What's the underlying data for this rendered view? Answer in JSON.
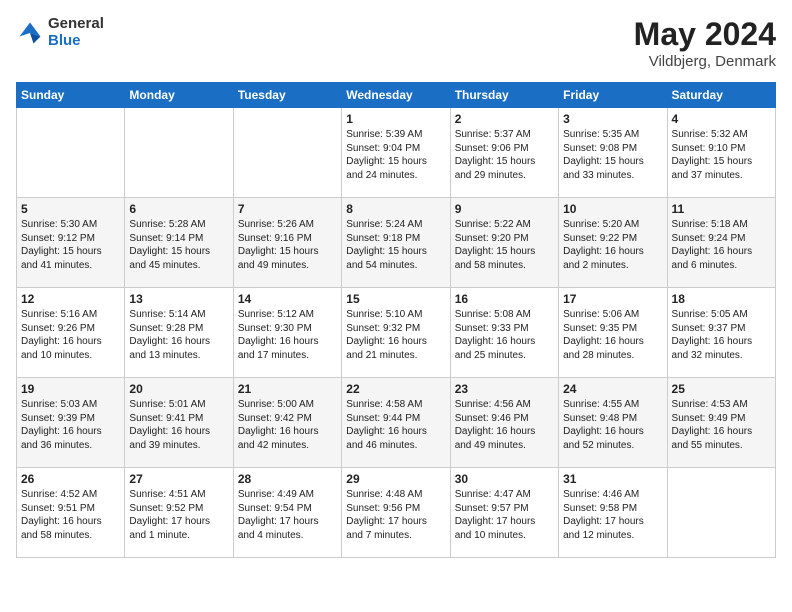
{
  "logo": {
    "general": "General",
    "blue": "Blue"
  },
  "title": {
    "month_year": "May 2024",
    "location": "Vildbjerg, Denmark"
  },
  "weekdays": [
    "Sunday",
    "Monday",
    "Tuesday",
    "Wednesday",
    "Thursday",
    "Friday",
    "Saturday"
  ],
  "weeks": [
    [
      {
        "day": "",
        "info": ""
      },
      {
        "day": "",
        "info": ""
      },
      {
        "day": "",
        "info": ""
      },
      {
        "day": "1",
        "info": "Sunrise: 5:39 AM\nSunset: 9:04 PM\nDaylight: 15 hours\nand 24 minutes."
      },
      {
        "day": "2",
        "info": "Sunrise: 5:37 AM\nSunset: 9:06 PM\nDaylight: 15 hours\nand 29 minutes."
      },
      {
        "day": "3",
        "info": "Sunrise: 5:35 AM\nSunset: 9:08 PM\nDaylight: 15 hours\nand 33 minutes."
      },
      {
        "day": "4",
        "info": "Sunrise: 5:32 AM\nSunset: 9:10 PM\nDaylight: 15 hours\nand 37 minutes."
      }
    ],
    [
      {
        "day": "5",
        "info": "Sunrise: 5:30 AM\nSunset: 9:12 PM\nDaylight: 15 hours\nand 41 minutes."
      },
      {
        "day": "6",
        "info": "Sunrise: 5:28 AM\nSunset: 9:14 PM\nDaylight: 15 hours\nand 45 minutes."
      },
      {
        "day": "7",
        "info": "Sunrise: 5:26 AM\nSunset: 9:16 PM\nDaylight: 15 hours\nand 49 minutes."
      },
      {
        "day": "8",
        "info": "Sunrise: 5:24 AM\nSunset: 9:18 PM\nDaylight: 15 hours\nand 54 minutes."
      },
      {
        "day": "9",
        "info": "Sunrise: 5:22 AM\nSunset: 9:20 PM\nDaylight: 15 hours\nand 58 minutes."
      },
      {
        "day": "10",
        "info": "Sunrise: 5:20 AM\nSunset: 9:22 PM\nDaylight: 16 hours\nand 2 minutes."
      },
      {
        "day": "11",
        "info": "Sunrise: 5:18 AM\nSunset: 9:24 PM\nDaylight: 16 hours\nand 6 minutes."
      }
    ],
    [
      {
        "day": "12",
        "info": "Sunrise: 5:16 AM\nSunset: 9:26 PM\nDaylight: 16 hours\nand 10 minutes."
      },
      {
        "day": "13",
        "info": "Sunrise: 5:14 AM\nSunset: 9:28 PM\nDaylight: 16 hours\nand 13 minutes."
      },
      {
        "day": "14",
        "info": "Sunrise: 5:12 AM\nSunset: 9:30 PM\nDaylight: 16 hours\nand 17 minutes."
      },
      {
        "day": "15",
        "info": "Sunrise: 5:10 AM\nSunset: 9:32 PM\nDaylight: 16 hours\nand 21 minutes."
      },
      {
        "day": "16",
        "info": "Sunrise: 5:08 AM\nSunset: 9:33 PM\nDaylight: 16 hours\nand 25 minutes."
      },
      {
        "day": "17",
        "info": "Sunrise: 5:06 AM\nSunset: 9:35 PM\nDaylight: 16 hours\nand 28 minutes."
      },
      {
        "day": "18",
        "info": "Sunrise: 5:05 AM\nSunset: 9:37 PM\nDaylight: 16 hours\nand 32 minutes."
      }
    ],
    [
      {
        "day": "19",
        "info": "Sunrise: 5:03 AM\nSunset: 9:39 PM\nDaylight: 16 hours\nand 36 minutes."
      },
      {
        "day": "20",
        "info": "Sunrise: 5:01 AM\nSunset: 9:41 PM\nDaylight: 16 hours\nand 39 minutes."
      },
      {
        "day": "21",
        "info": "Sunrise: 5:00 AM\nSunset: 9:42 PM\nDaylight: 16 hours\nand 42 minutes."
      },
      {
        "day": "22",
        "info": "Sunrise: 4:58 AM\nSunset: 9:44 PM\nDaylight: 16 hours\nand 46 minutes."
      },
      {
        "day": "23",
        "info": "Sunrise: 4:56 AM\nSunset: 9:46 PM\nDaylight: 16 hours\nand 49 minutes."
      },
      {
        "day": "24",
        "info": "Sunrise: 4:55 AM\nSunset: 9:48 PM\nDaylight: 16 hours\nand 52 minutes."
      },
      {
        "day": "25",
        "info": "Sunrise: 4:53 AM\nSunset: 9:49 PM\nDaylight: 16 hours\nand 55 minutes."
      }
    ],
    [
      {
        "day": "26",
        "info": "Sunrise: 4:52 AM\nSunset: 9:51 PM\nDaylight: 16 hours\nand 58 minutes."
      },
      {
        "day": "27",
        "info": "Sunrise: 4:51 AM\nSunset: 9:52 PM\nDaylight: 17 hours\nand 1 minute."
      },
      {
        "day": "28",
        "info": "Sunrise: 4:49 AM\nSunset: 9:54 PM\nDaylight: 17 hours\nand 4 minutes."
      },
      {
        "day": "29",
        "info": "Sunrise: 4:48 AM\nSunset: 9:56 PM\nDaylight: 17 hours\nand 7 minutes."
      },
      {
        "day": "30",
        "info": "Sunrise: 4:47 AM\nSunset: 9:57 PM\nDaylight: 17 hours\nand 10 minutes."
      },
      {
        "day": "31",
        "info": "Sunrise: 4:46 AM\nSunset: 9:58 PM\nDaylight: 17 hours\nand 12 minutes."
      },
      {
        "day": "",
        "info": ""
      }
    ]
  ]
}
